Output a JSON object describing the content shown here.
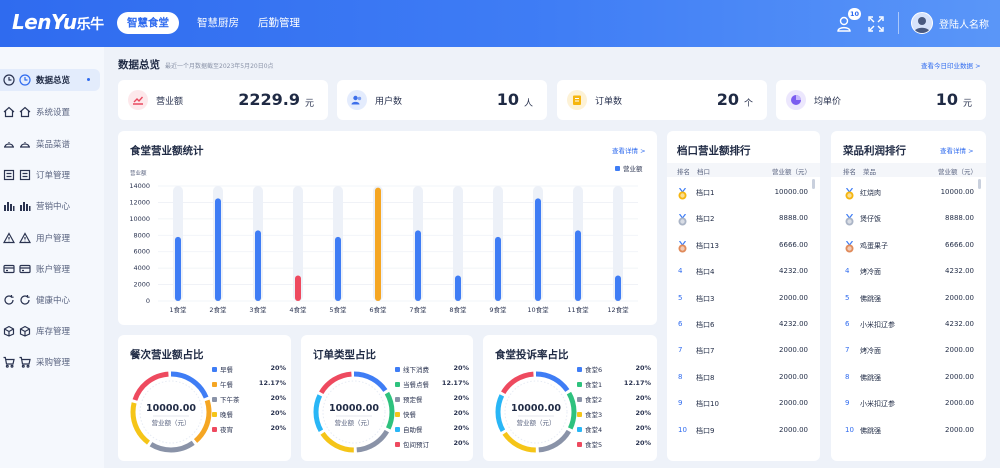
{
  "header": {
    "logo_en": "LenYu",
    "logo_cn": "乐牛",
    "tabs": [
      {
        "label": "智慧食堂",
        "active": true
      },
      {
        "label": "智慧厨房",
        "active": false
      },
      {
        "label": "后勤管理",
        "active": false
      }
    ],
    "notification_count": "10",
    "user_name": "登陆人名称",
    "icons": [
      "user-notify-icon",
      "fullscreen-icon",
      "avatar"
    ]
  },
  "sidebar": {
    "items": [
      {
        "label": "数据总览",
        "icon": "clock-icon",
        "active": true
      },
      {
        "label": "系统设置",
        "icon": "home-icon",
        "active": false
      },
      {
        "label": "菜品菜谱",
        "icon": "dish-cover-icon",
        "active": false
      },
      {
        "label": "订单管理",
        "icon": "list-icon",
        "active": false
      },
      {
        "label": "营销中心",
        "icon": "bar-chart-icon",
        "active": false
      },
      {
        "label": "用户管理",
        "icon": "warning-icon",
        "active": false
      },
      {
        "label": "账户管理",
        "icon": "card-icon",
        "active": false
      },
      {
        "label": "健康中心",
        "icon": "refresh-icon",
        "active": false
      },
      {
        "label": "库存管理",
        "icon": "box-icon",
        "active": false
      },
      {
        "label": "采购管理",
        "icon": "cart-icon",
        "active": false
      }
    ]
  },
  "overview": {
    "title": "数据总览",
    "subtitle": "最近一个月数据截至2023年5月20日0点",
    "link": "查看今日印业数据 >"
  },
  "kpis": [
    {
      "label": "营业额",
      "value": "2229.9",
      "unit": "元",
      "icon": "trend-icon",
      "color": "#e9495f",
      "bg": "#fde8eb"
    },
    {
      "label": "用户数",
      "value": "10",
      "unit": "人",
      "icon": "users-icon",
      "color": "#3d6fea",
      "bg": "#e4ecfd"
    },
    {
      "label": "订单数",
      "value": "20",
      "unit": "个",
      "icon": "order-icon",
      "color": "#f5b50f",
      "bg": "#fdf2d6"
    },
    {
      "label": "均单价",
      "value": "10",
      "unit": "元",
      "icon": "pie-icon",
      "color": "#7b5cf0",
      "bg": "#ece7fd"
    }
  ],
  "revenue_chart": {
    "title": "食堂营业额统计",
    "link": "查看详情 >",
    "legend": "营业额",
    "ylabel": "营业额"
  },
  "chart_data": {
    "type": "bar",
    "title": "食堂营业额统计",
    "ylabel": "营业额",
    "legend": [
      "营业额"
    ],
    "legend_position": "top-right",
    "ylim": [
      0,
      14000
    ],
    "yticks": [
      0,
      2000,
      4000,
      6000,
      8000,
      10000,
      12000,
      14000
    ],
    "categories": [
      "1食堂",
      "2食堂",
      "3食堂",
      "4食堂",
      "5食堂",
      "6食堂",
      "7食堂",
      "8食堂",
      "9食堂",
      "10食堂",
      "11食堂",
      "12食堂"
    ],
    "series": [
      {
        "name": "营业额",
        "values": [
          7800,
          12500,
          8600,
          3100,
          7800,
          13800,
          8600,
          3100,
          7800,
          12500,
          8600,
          3100
        ]
      }
    ],
    "bar_colors": [
      "#3f7df5",
      "#3f7df5",
      "#3f7df5",
      "#ee4a5f",
      "#3f7df5",
      "#f5a623",
      "#3f7df5",
      "#3f7df5",
      "#3f7df5",
      "#3f7df5",
      "#3f7df5",
      "#3f7df5"
    ],
    "grid": true
  },
  "stall_rank": {
    "title": "档口营业额排行",
    "headers": [
      "排名",
      "档口",
      "营业额（元）"
    ],
    "rows": [
      {
        "rank": "1",
        "name": "档口1",
        "value": "10000.00"
      },
      {
        "rank": "2",
        "name": "档口2",
        "value": "8888.00"
      },
      {
        "rank": "3",
        "name": "档口13",
        "value": "6666.00"
      },
      {
        "rank": "4",
        "name": "档口4",
        "value": "4232.00"
      },
      {
        "rank": "5",
        "name": "档口3",
        "value": "2000.00"
      },
      {
        "rank": "6",
        "name": "档口6",
        "value": "4232.00"
      },
      {
        "rank": "7",
        "name": "档口7",
        "value": "2000.00"
      },
      {
        "rank": "8",
        "name": "档口8",
        "value": "2000.00"
      },
      {
        "rank": "9",
        "name": "档口10",
        "value": "2000.00"
      },
      {
        "rank": "10",
        "name": "档口9",
        "value": "2000.00"
      }
    ]
  },
  "dish_rank": {
    "title": "菜品利润排行",
    "link": "查看详情 >",
    "headers": [
      "排名",
      "菜品",
      "营业额（元）"
    ],
    "rows": [
      {
        "rank": "1",
        "name": "红烧肉",
        "value": "10000.00"
      },
      {
        "rank": "2",
        "name": "煲仔饭",
        "value": "8888.00"
      },
      {
        "rank": "3",
        "name": "鸡蛋果子",
        "value": "6666.00"
      },
      {
        "rank": "4",
        "name": "烤冷面",
        "value": "4232.00"
      },
      {
        "rank": "5",
        "name": "佛跳强",
        "value": "2000.00"
      },
      {
        "rank": "6",
        "name": "小米扣辽参",
        "value": "4232.00"
      },
      {
        "rank": "7",
        "name": "烤冷面",
        "value": "2000.00"
      },
      {
        "rank": "8",
        "name": "佛跳强",
        "value": "2000.00"
      },
      {
        "rank": "9",
        "name": "小米扣辽参",
        "value": "2000.00"
      },
      {
        "rank": "10",
        "name": "佛跳强",
        "value": "2000.00"
      }
    ]
  },
  "donuts": [
    {
      "title": "餐次营业额占比",
      "center_value": "10000.00",
      "center_label": "营业额（元）",
      "legend": [
        {
          "name": "早餐",
          "value": "20%",
          "color": "#3f7df5"
        },
        {
          "name": "午餐",
          "value": "12.17%",
          "color": "#f5a623"
        },
        {
          "name": "下午茶",
          "value": "20%",
          "color": "#8a93a8"
        },
        {
          "name": "晚餐",
          "value": "20%",
          "color": "#f5c518"
        },
        {
          "name": "夜宵",
          "value": "20%",
          "color": "#ee4a5f"
        }
      ]
    },
    {
      "title": "订单类型占比",
      "center_value": "10000.00",
      "center_label": "营业额（元）",
      "legend": [
        {
          "name": "线下消费",
          "value": "20%",
          "color": "#3f7df5"
        },
        {
          "name": "当餐点餐",
          "value": "12.17%",
          "color": "#2ec27e"
        },
        {
          "name": "预定餐",
          "value": "20%",
          "color": "#8a93a8"
        },
        {
          "name": "快餐",
          "value": "20%",
          "color": "#f5c518"
        },
        {
          "name": "自助餐",
          "value": "20%",
          "color": "#29b6f6"
        },
        {
          "name": "包间预订",
          "value": "20%",
          "color": "#ee4a5f"
        }
      ]
    },
    {
      "title": "食堂投诉率占比",
      "center_value": "10000.00",
      "center_label": "营业额（元）",
      "legend": [
        {
          "name": "食堂6",
          "value": "20%",
          "color": "#3f7df5"
        },
        {
          "name": "食堂1",
          "value": "12.17%",
          "color": "#2ec27e"
        },
        {
          "name": "食堂2",
          "value": "20%",
          "color": "#8a93a8"
        },
        {
          "name": "食堂3",
          "value": "20%",
          "color": "#f5c518"
        },
        {
          "name": "食堂4",
          "value": "20%",
          "color": "#29b6f6"
        },
        {
          "name": "食堂5",
          "value": "20%",
          "color": "#ee4a5f"
        }
      ]
    }
  ]
}
